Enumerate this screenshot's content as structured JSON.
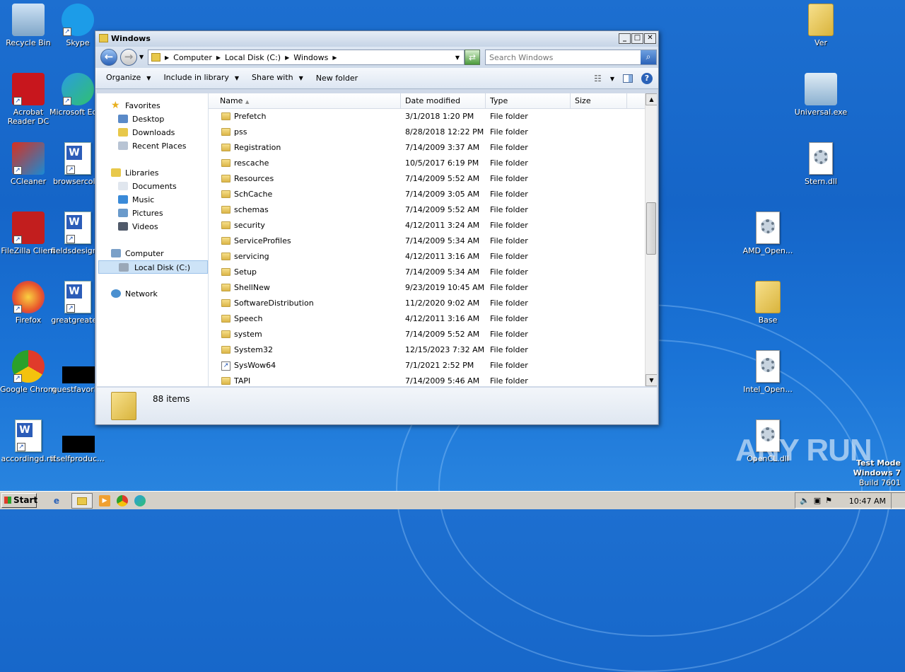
{
  "desktop": {
    "left_icons": [
      {
        "label": "Recycle Bin",
        "icon": "recycle-bin-icon"
      },
      {
        "label": "Skype",
        "icon": "skype-icon"
      },
      {
        "label": "Acrobat Reader DC",
        "icon": "acrobat-icon"
      },
      {
        "label": "Microsoft Edge",
        "icon": "edge-icon"
      },
      {
        "label": "CCleaner",
        "icon": "ccleaner-icon"
      },
      {
        "label": "browsercol...",
        "icon": "word-doc-icon"
      },
      {
        "label": "FileZilla Client",
        "icon": "filezilla-icon"
      },
      {
        "label": "fieldsdesign...",
        "icon": "word-doc-icon"
      },
      {
        "label": "Firefox",
        "icon": "firefox-icon"
      },
      {
        "label": "greatgreate...",
        "icon": "word-doc-icon"
      },
      {
        "label": "Google Chrome",
        "icon": "chrome-icon"
      },
      {
        "label": "guestfavori...",
        "icon": "redacted-icon"
      },
      {
        "label": "accordingd.rtf",
        "icon": "word-doc-icon"
      },
      {
        "label": "itselfproduc...",
        "icon": "redacted-icon"
      }
    ],
    "right_icons": [
      {
        "label": "Ver",
        "icon": "folder-icon"
      },
      {
        "label": "Universal.exe",
        "icon": "exe-icon"
      },
      {
        "label": "Stern.dll",
        "icon": "dll-icon"
      },
      {
        "label": "AMD_Open...",
        "icon": "dll-icon"
      },
      {
        "label": "Base",
        "icon": "folder-icon"
      },
      {
        "label": "Intel_Open...",
        "icon": "dll-icon"
      },
      {
        "label": "OpenCL.dll",
        "icon": "dll-icon"
      }
    ],
    "watermark": {
      "line1": "Test Mode",
      "line2": "Windows 7",
      "line3": "Build 7601"
    },
    "anyrun_text": "ANY RUN"
  },
  "window": {
    "title": "Windows",
    "address": {
      "parts": [
        "Computer",
        "Local Disk (C:)",
        "Windows"
      ]
    },
    "search_placeholder": "Search Windows",
    "toolbar": {
      "organize": "Organize",
      "include": "Include in library",
      "share": "Share with",
      "new_folder": "New folder"
    },
    "nav": {
      "favorites": "Favorites",
      "favorites_items": [
        "Desktop",
        "Downloads",
        "Recent Places"
      ],
      "libraries": "Libraries",
      "libraries_items": [
        "Documents",
        "Music",
        "Pictures",
        "Videos"
      ],
      "computer": "Computer",
      "computer_items": [
        "Local Disk (C:)"
      ],
      "network": "Network"
    },
    "columns": [
      "Name",
      "Date modified",
      "Type",
      "Size"
    ],
    "files": [
      {
        "name": "Prefetch",
        "date": "3/1/2018 1:20 PM",
        "type": "File folder"
      },
      {
        "name": "pss",
        "date": "8/28/2018 12:22 PM",
        "type": "File folder"
      },
      {
        "name": "Registration",
        "date": "7/14/2009 3:37 AM",
        "type": "File folder"
      },
      {
        "name": "rescache",
        "date": "10/5/2017 6:19 PM",
        "type": "File folder"
      },
      {
        "name": "Resources",
        "date": "7/14/2009 5:52 AM",
        "type": "File folder"
      },
      {
        "name": "SchCache",
        "date": "7/14/2009 3:05 AM",
        "type": "File folder"
      },
      {
        "name": "schemas",
        "date": "7/14/2009 5:52 AM",
        "type": "File folder"
      },
      {
        "name": "security",
        "date": "4/12/2011 3:24 AM",
        "type": "File folder"
      },
      {
        "name": "ServiceProfiles",
        "date": "7/14/2009 5:34 AM",
        "type": "File folder"
      },
      {
        "name": "servicing",
        "date": "4/12/2011 3:16 AM",
        "type": "File folder"
      },
      {
        "name": "Setup",
        "date": "7/14/2009 5:34 AM",
        "type": "File folder"
      },
      {
        "name": "ShellNew",
        "date": "9/23/2019 10:45 AM",
        "type": "File folder"
      },
      {
        "name": "SoftwareDistribution",
        "date": "11/2/2020 9:02 AM",
        "type": "File folder"
      },
      {
        "name": "Speech",
        "date": "4/12/2011 3:16 AM",
        "type": "File folder"
      },
      {
        "name": "system",
        "date": "7/14/2009 5:52 AM",
        "type": "File folder"
      },
      {
        "name": "System32",
        "date": "12/15/2023 7:32 AM",
        "type": "File folder"
      },
      {
        "name": "SysWow64",
        "date": "7/1/2021 2:52 PM",
        "type": "File folder"
      },
      {
        "name": "TAPI",
        "date": "7/14/2009 5:46 AM",
        "type": "File folder"
      }
    ],
    "status": "88 items"
  },
  "taskbar": {
    "start": "Start",
    "clock": "10:47 AM"
  }
}
